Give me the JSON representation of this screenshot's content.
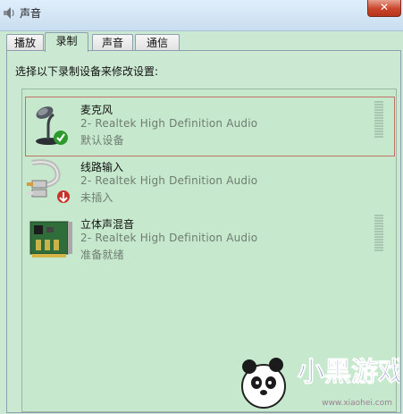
{
  "window": {
    "title": "声音",
    "close_glyph": "✕"
  },
  "tabs": [
    {
      "label": "播放"
    },
    {
      "label": "录制",
      "active": true
    },
    {
      "label": "声音"
    },
    {
      "label": "通信"
    }
  ],
  "instruction": "选择以下录制设备来修改设置:",
  "devices": [
    {
      "name": "麦克风",
      "driver": "2- Realtek High Definition Audio",
      "status": "默认设备",
      "icon": "microphone-icon",
      "badge": "green-check-icon",
      "selected": true
    },
    {
      "name": "线路输入",
      "driver": "2- Realtek High Definition Audio",
      "status": "未插入",
      "icon": "audio-cable-icon",
      "badge": "red-down-arrow-icon",
      "selected": false
    },
    {
      "name": "立体声混音",
      "driver": "2- Realtek High Definition Audio",
      "status": "准备就绪",
      "icon": "sound-card-icon",
      "selected": false
    }
  ],
  "watermark": {
    "text": "小黑游戏",
    "url": "www.xiaohei.com"
  },
  "colors": {
    "background": "#cbe8d2",
    "selection_border": "#c07266",
    "secondary_text": "#6e7c72"
  }
}
